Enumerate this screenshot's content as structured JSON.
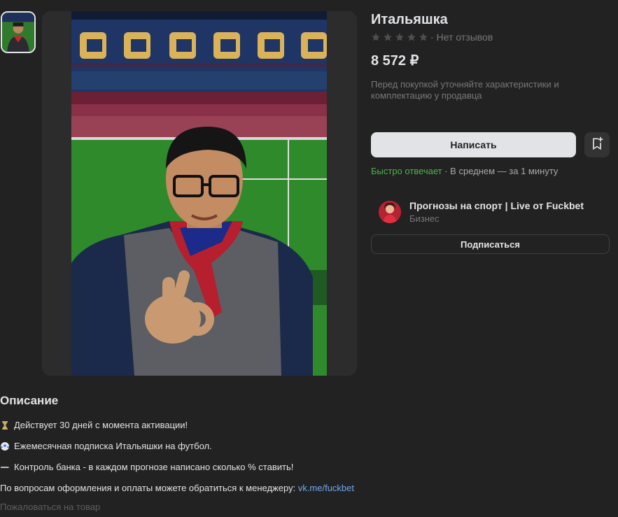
{
  "product": {
    "title": "Итальяшка",
    "rating_text": "Нет отзывов",
    "stars_filled": 0,
    "stars_total": 5,
    "price": "8 572 ₽",
    "note": "Перед покупкой уточняйте характеристики и комплектацию у продавца"
  },
  "actions": {
    "write_label": "Написать",
    "favorite_icon": "bookmark-plus-icon",
    "response_fast": "Быстро отвечает",
    "response_avg": " · В среднем — за 1 минуту"
  },
  "shop": {
    "name": "Прогнозы на спорт | Live от Fuckbet",
    "type": "Бизнес",
    "subscribe_label": "Подписаться"
  },
  "description": {
    "title": "Описание",
    "line1": "Действует 30 дней с момента активации!",
    "line2": "Ежемесячная подписка Итальяшки на футбол.",
    "line3": "Контроль банка - в каждом прогнозе написано сколько % ставить!",
    "line4_text": "По вопросам оформления и оплаты можете обратиться к менеджеру: ",
    "line4_link": "vk.me/fuckbet"
  },
  "footer": {
    "report": "Пожаловаться на товар"
  },
  "colors": {
    "background": "#222222",
    "accent_green": "#4bb34b",
    "link_blue": "#71aaeb"
  }
}
